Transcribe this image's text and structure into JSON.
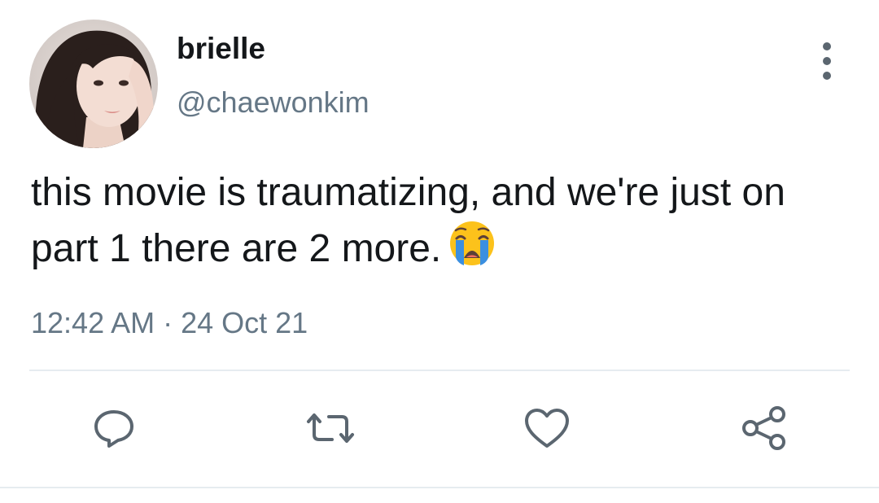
{
  "user": {
    "display_name": "brielle",
    "handle": "@chaewonkim"
  },
  "tweet": {
    "text": "this movie is traumatizing, and we're just on part 1 there are 2 more.",
    "emoji": "loudly-crying-face",
    "timestamp": "12:42 AM · 24 Oct 21"
  },
  "actions": {
    "reply_icon": "reply-icon",
    "retweet_icon": "retweet-icon",
    "like_icon": "heart-icon",
    "share_icon": "share-icon",
    "more_icon": "more-vertical-icon"
  },
  "colors": {
    "text_primary": "#14171a",
    "text_secondary": "#657786",
    "icon": "#5b6670",
    "divider": "#e6ecf0"
  }
}
